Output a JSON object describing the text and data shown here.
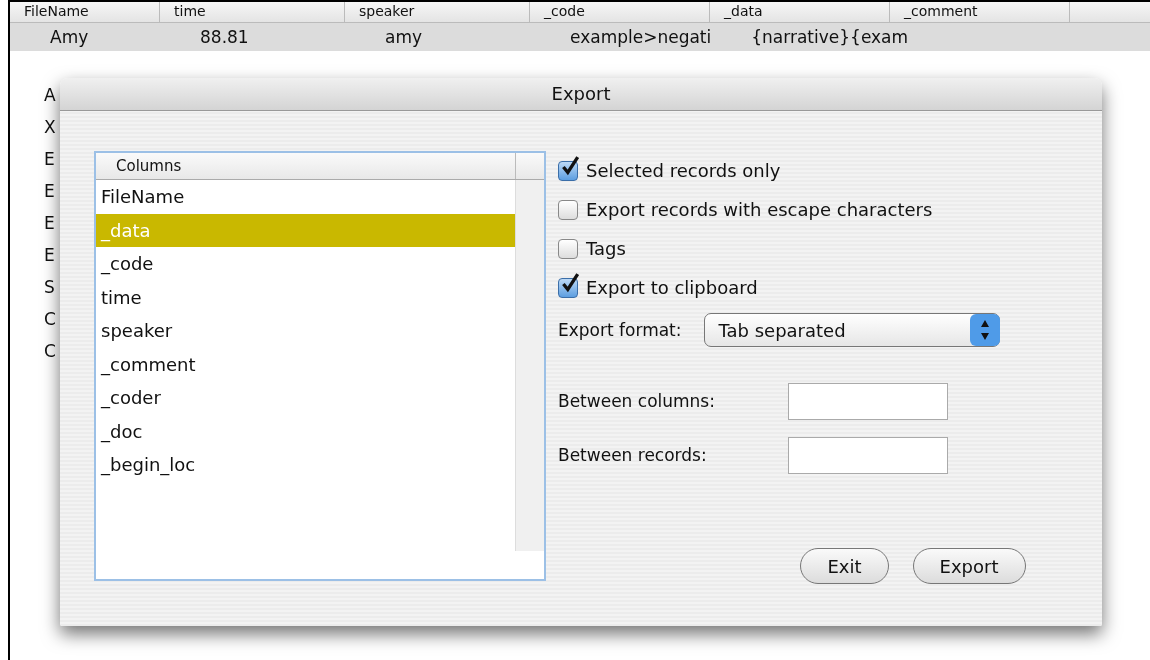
{
  "table": {
    "columns": [
      "FileName",
      "time",
      "speaker",
      "_code",
      "_data",
      "_comment"
    ],
    "rows": [
      {
        "cells": [
          "Amy",
          "88.81",
          "amy",
          "example>negati",
          "{narrative}{exam"
        ],
        "selected": true
      },
      {
        "cells": [
          "A"
        ],
        "selected": false
      },
      {
        "cells": [
          "X"
        ],
        "selected": false
      },
      {
        "cells": [
          "E"
        ],
        "selected": false
      },
      {
        "cells": [
          "E"
        ],
        "selected": false
      },
      {
        "cells": [
          "E"
        ],
        "selected": false
      },
      {
        "cells": [
          "E"
        ],
        "selected": false
      },
      {
        "cells": [
          "S"
        ],
        "selected": false
      },
      {
        "cells": [
          "C"
        ],
        "selected": false
      },
      {
        "cells": [
          "C"
        ],
        "selected": false
      }
    ]
  },
  "dialog": {
    "title": "Export",
    "list": {
      "header": "Columns",
      "items": [
        {
          "label": "FileName",
          "selected": false
        },
        {
          "label": "_data",
          "selected": true
        },
        {
          "label": "_code",
          "selected": false
        },
        {
          "label": "time",
          "selected": false
        },
        {
          "label": "speaker",
          "selected": false
        },
        {
          "label": "_comment",
          "selected": false
        },
        {
          "label": "_coder",
          "selected": false
        },
        {
          "label": "_doc",
          "selected": false
        },
        {
          "label": "_begin_loc",
          "selected": false
        }
      ]
    },
    "options": [
      {
        "label": "Selected records only",
        "checked": true
      },
      {
        "label": "Export records with escape characters",
        "checked": false
      },
      {
        "label": "Tags",
        "checked": false
      },
      {
        "label": "Export to clipboard",
        "checked": true
      }
    ],
    "format": {
      "label": "Export format:",
      "value": "Tab separated"
    },
    "fields": [
      {
        "label": "Between columns:"
      },
      {
        "label": "Between records:"
      }
    ],
    "buttons": [
      "Exit",
      "Export"
    ]
  }
}
